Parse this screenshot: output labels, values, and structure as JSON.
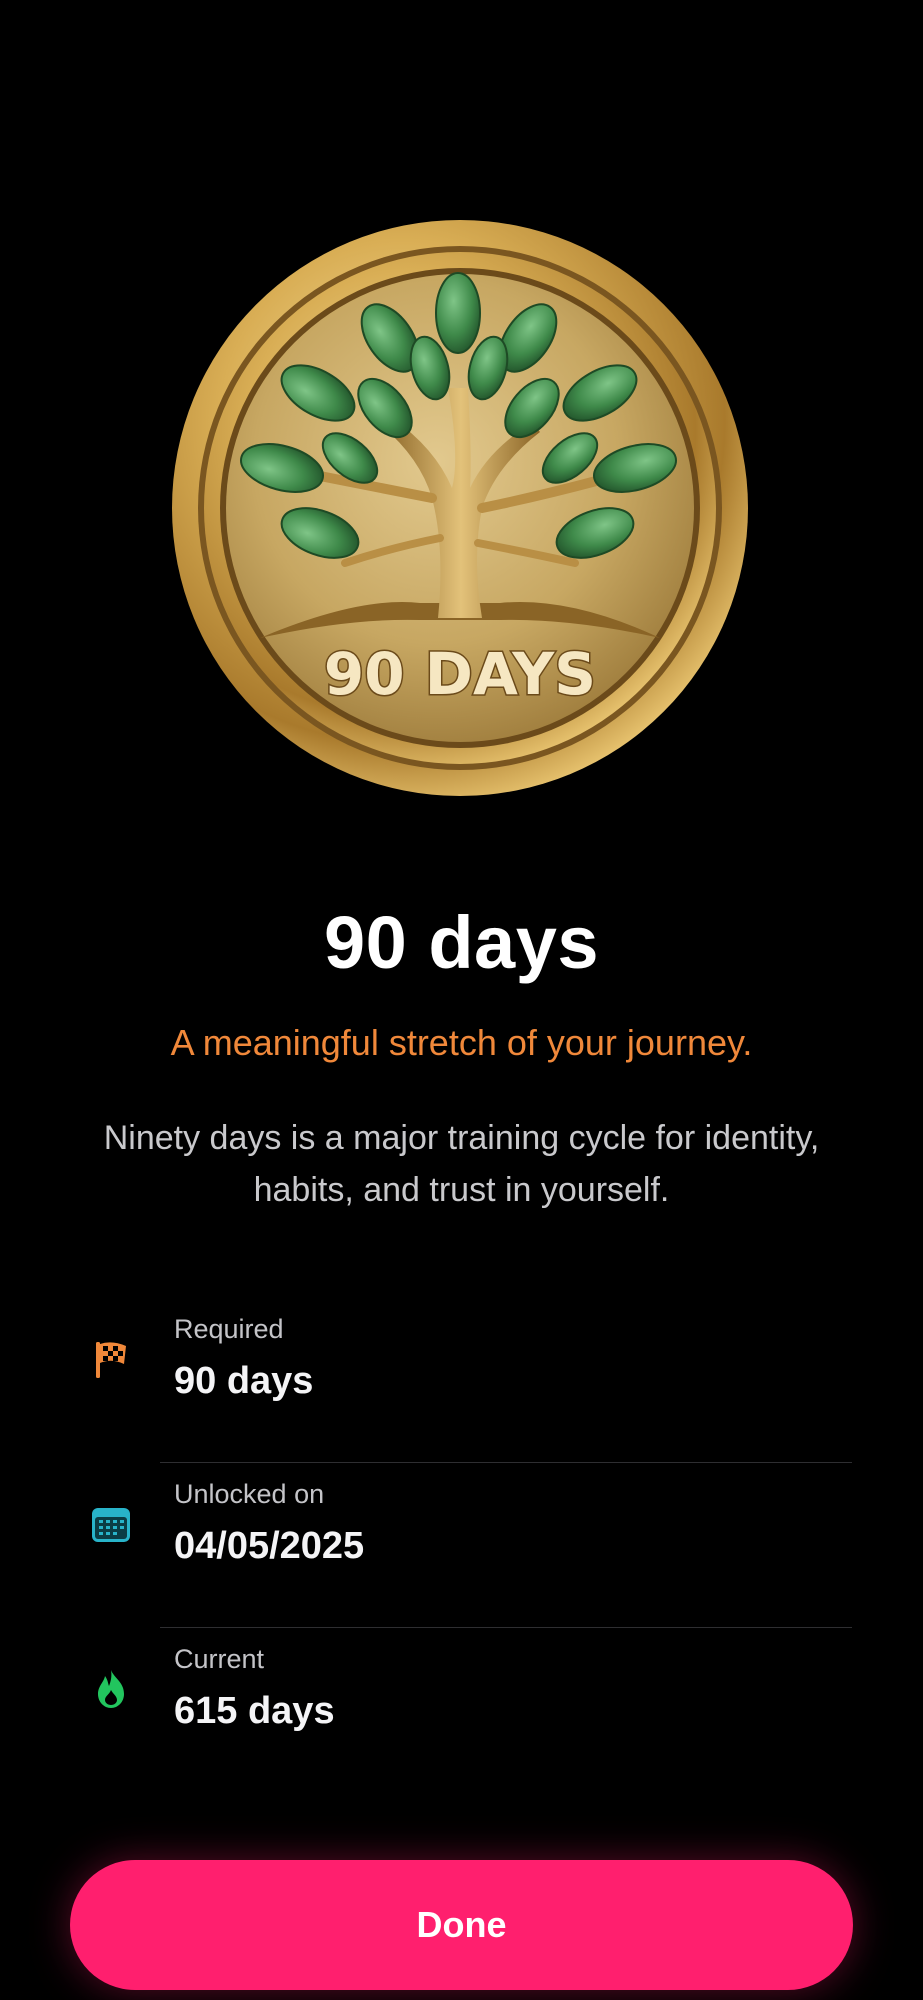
{
  "medal": {
    "icon": "tree-medal-icon",
    "text": "90 DAYS",
    "colors": {
      "gold": "#c9a24a",
      "leaf": "#3f8a4a"
    }
  },
  "milestone": {
    "title": "90 days",
    "subtitle": "A meaningful stretch of your journey.",
    "description": "Ninety days is a major training cycle for identity, habits, and trust in yourself."
  },
  "details": [
    {
      "icon": "checkered-flag-icon",
      "label": "Required",
      "value": "90 days",
      "color": "#f0883a"
    },
    {
      "icon": "calendar-icon",
      "label": "Unlocked on",
      "value": "04/05/2025",
      "color": "#28b3c9"
    },
    {
      "icon": "flame-icon",
      "label": "Current",
      "value": "615 days",
      "color": "#22c55e"
    }
  ],
  "actions": {
    "done_label": "Done"
  },
  "theme": {
    "accent": "#ff1f6e",
    "subtitle_color": "#f0883a",
    "background": "#000000"
  }
}
